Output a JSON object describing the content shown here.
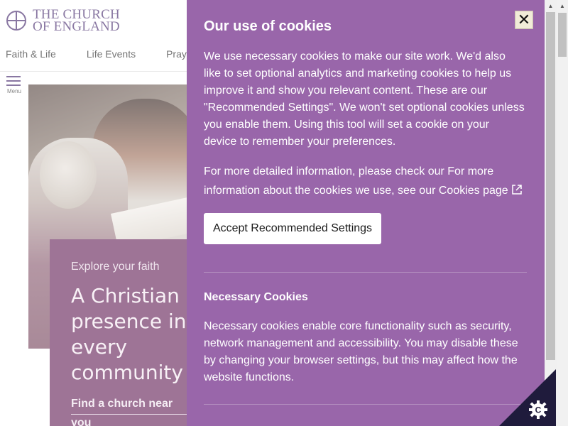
{
  "site": {
    "logo_line1": "THE CHURCH",
    "logo_line2": "OF ENGLAND"
  },
  "nav": {
    "items": [
      "Faith & Life",
      "Life Events",
      "Prayer"
    ]
  },
  "menu": {
    "label": "Menu"
  },
  "hero_card": {
    "kicker": "Explore your faith",
    "title": "A Christian presence in every community",
    "find": "Find a church near you"
  },
  "cookie_panel": {
    "title": "Our use of cookies",
    "close_label": "✕",
    "intro": "We use necessary cookies to make our site work. We'd also like to set optional analytics and marketing cookies to help us improve it and show you relevant content. These are our \"Recommended Settings\". We won't set optional cookies unless you enable them. Using this tool will set a cookie on your device to remember your preferences.",
    "more_info_prefix": "For more detailed information, please check our ",
    "more_info_link": "For more information about the cookies we use, see our Cookies page",
    "accept_button": "Accept Recommended Settings",
    "necessary_title": "Necessary Cookies",
    "necessary_text": "Necessary cookies enable core functionality such as security, network management and accessibility. You may disable these by changing your browser settings, but this may affect how the website functions."
  },
  "colors": {
    "panel_bg": "#9966aa",
    "card_bg": "#6b2a5f",
    "brand_purple": "#4a2e70",
    "badge_bg": "#1f1b3c"
  },
  "icons": {
    "close": "close-icon",
    "external": "external-link-icon",
    "menu": "hamburger-icon",
    "cookie_settings": "cookie-gear-icon",
    "logo": "church-logo-icon"
  }
}
